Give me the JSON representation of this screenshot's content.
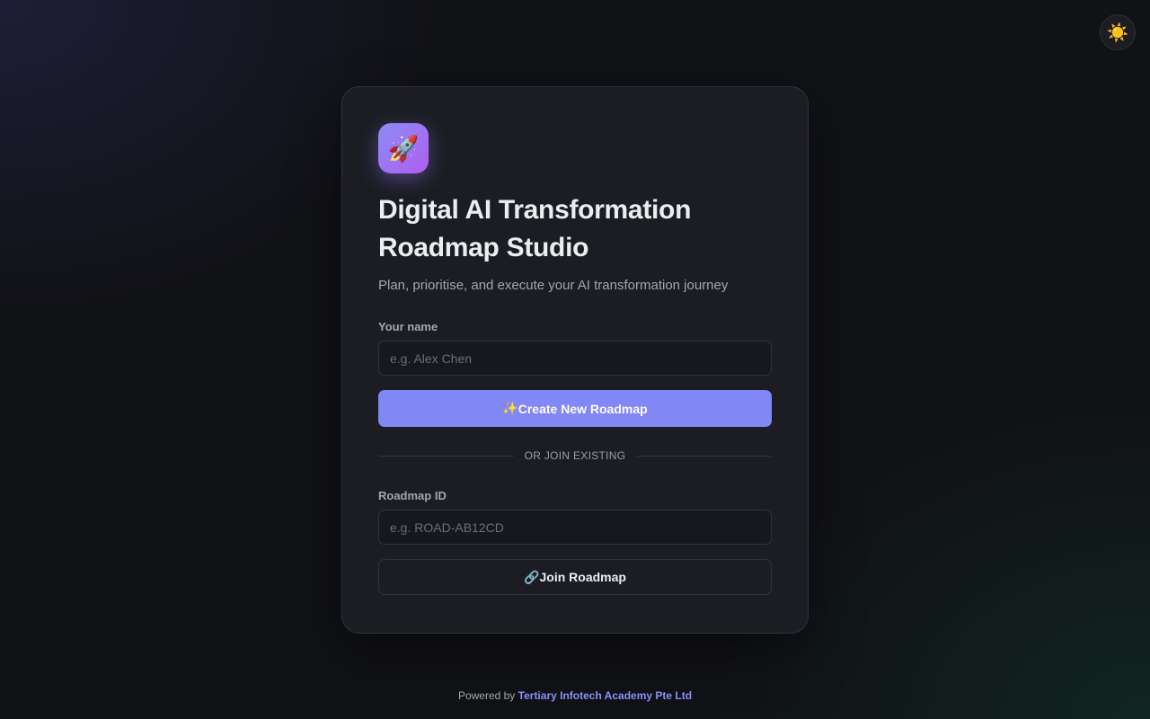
{
  "theme_toggle": {
    "icon": "sun-icon",
    "glyph": "☀️"
  },
  "card": {
    "logo_glyph": "🚀",
    "title_line1": "Digital AI Transformation",
    "title_line2": "Roadmap Studio",
    "subtitle": "Plan, prioritise, and execute your AI transformation journey",
    "name_label": "Your name",
    "name_placeholder": "e.g. Alex Chen",
    "create_icon": "✨",
    "create_label": "Create New Roadmap",
    "divider_text": "OR JOIN EXISTING",
    "id_label": "Roadmap ID",
    "id_placeholder": "e.g. ROAD-AB12CD",
    "join_icon": "🔗",
    "join_label": "Join Roadmap"
  },
  "footer": {
    "prefix": "Powered by",
    "brand": "Tertiary Infotech Academy Pte Ltd"
  },
  "colors": {
    "accent": "#8187f5",
    "brand_link": "#8a8ff7",
    "background": "#111216",
    "card": "#1b1d23"
  }
}
